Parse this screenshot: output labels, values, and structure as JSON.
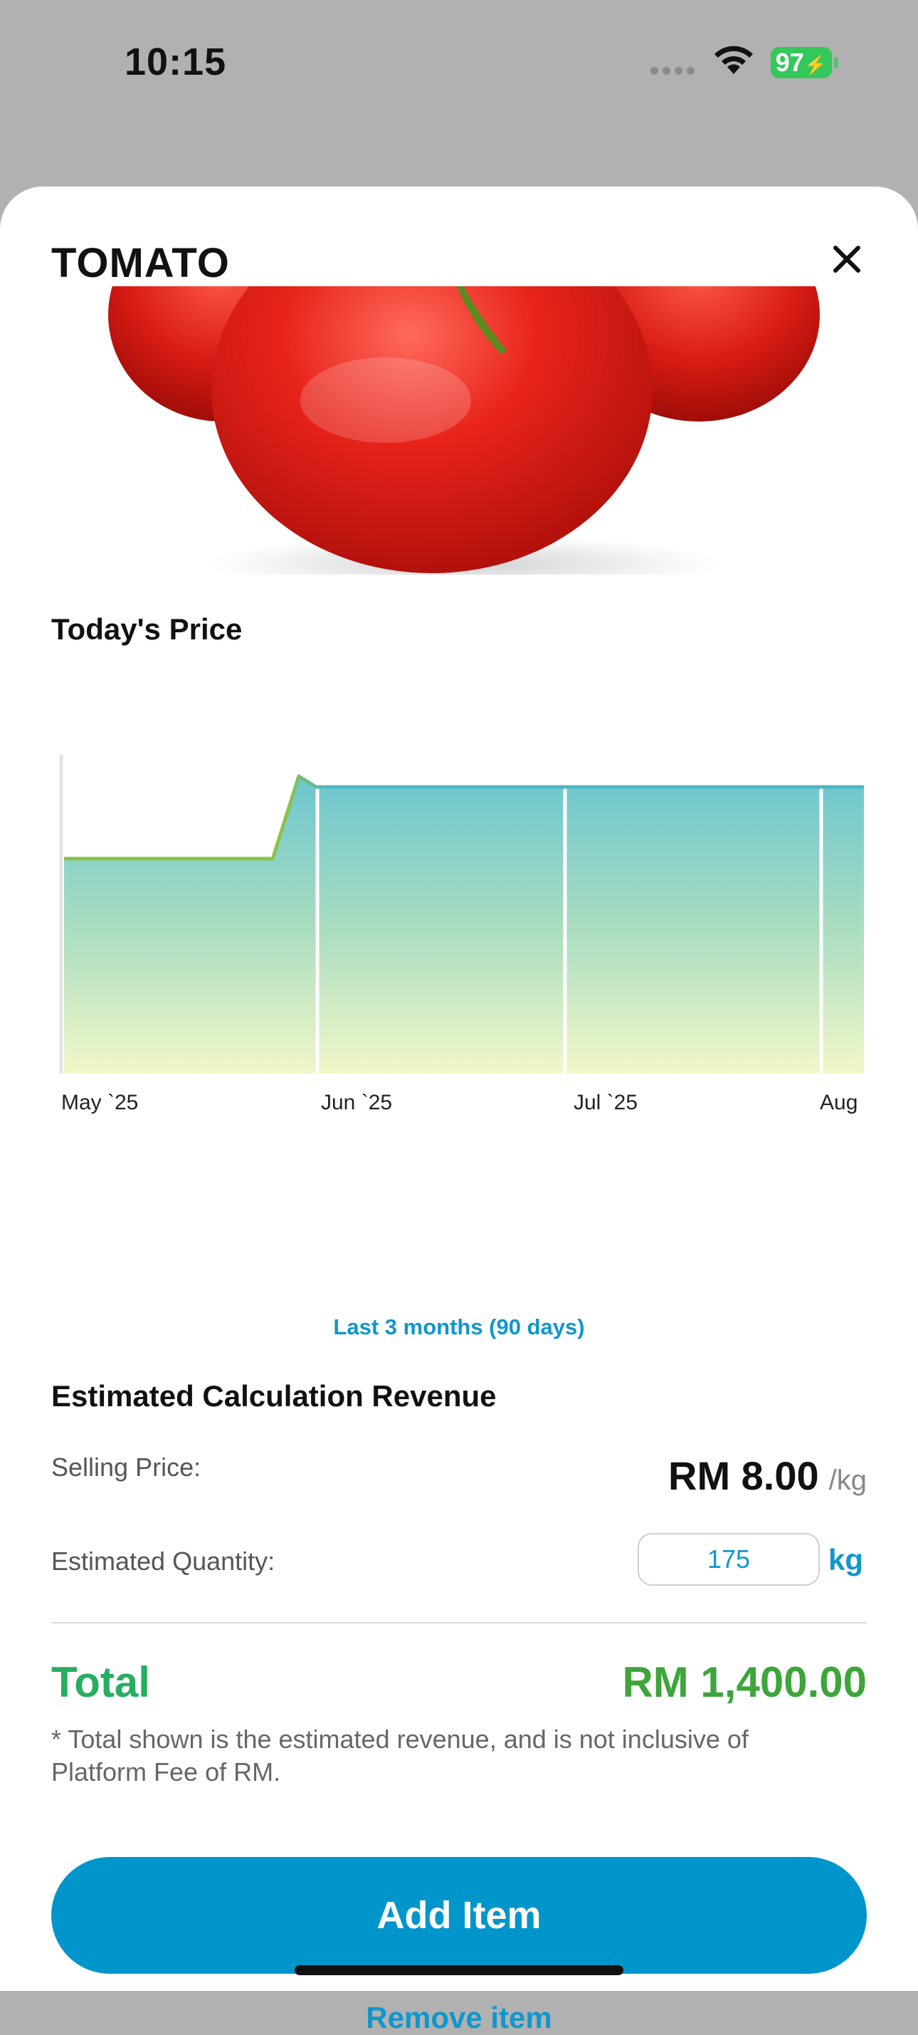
{
  "status_bar": {
    "time": "10:15",
    "battery": "97"
  },
  "sheet": {
    "title": "TOMATO",
    "close_icon": "close-icon",
    "price_label": "Today's Price"
  },
  "chart_data": {
    "type": "area",
    "x_ticks": [
      "May `25",
      "Jun `25",
      "Jul `25",
      "Aug"
    ],
    "series": [
      {
        "values_note": "",
        "points": [
          {
            "x": "2025-05-01",
            "y": 6.0
          },
          {
            "x": "2025-05-25",
            "y": 6.0
          },
          {
            "x": "2025-05-28",
            "y": 8.3
          },
          {
            "x": "2025-05-30",
            "y": 8.0
          },
          {
            "x": "2025-08-01",
            "y": 8.0
          }
        ]
      }
    ],
    "ylim": [
      0,
      8.5
    ],
    "grid": "vertical",
    "range_label": "Last 3 months (90 days)"
  },
  "calc": {
    "title": "Estimated Calculation Revenue",
    "selling_label": "Selling Price:",
    "selling_price": "RM 8.00",
    "selling_unit": "/kg",
    "quantity_label": "Estimated Quantity:",
    "quantity_value": "175",
    "quantity_unit": "kg",
    "total_label": "Total",
    "total_value": "RM 1,400.00",
    "note": "* Total shown is the estimated revenue, and is not inclusive of Platform Fee of RM."
  },
  "actions": {
    "add_label": "Add Item",
    "remove_label": "Remove item"
  },
  "colors": {
    "accent": "#0096cc",
    "total_green": "#27ae60",
    "line_green": "#8bc34a",
    "line_teal": "#4db6c4"
  }
}
